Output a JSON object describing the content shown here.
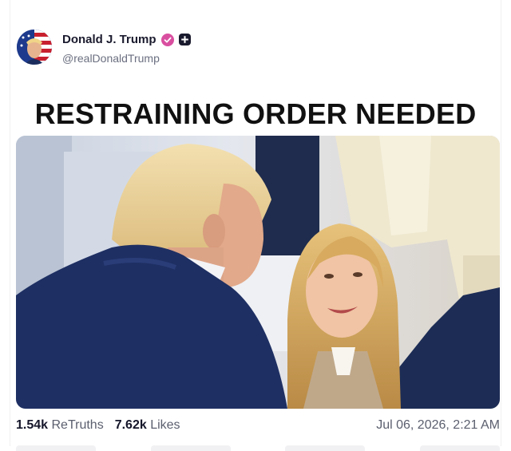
{
  "post": {
    "author": {
      "display_name": "Donald J. Trump",
      "handle": "@realDonaldTrump",
      "verified_icon": "verified-badge-icon",
      "follow_icon": "plus-icon"
    },
    "headline": "RESTRAINING ORDER NEEDED",
    "media": {
      "type": "photo"
    },
    "stats": {
      "retruths_count": "1.54k",
      "retruths_label": "ReTruths",
      "likes_count": "7.62k",
      "likes_label": "Likes"
    },
    "timestamp": "Jul 06, 2026, 2:21 AM"
  },
  "colors": {
    "verified_badge": "#d94fa0",
    "text_primary": "#15162a",
    "text_secondary": "#5b5f6e",
    "avatar_blue": "#1d3a8c",
    "avatar_red": "#c8202f"
  }
}
